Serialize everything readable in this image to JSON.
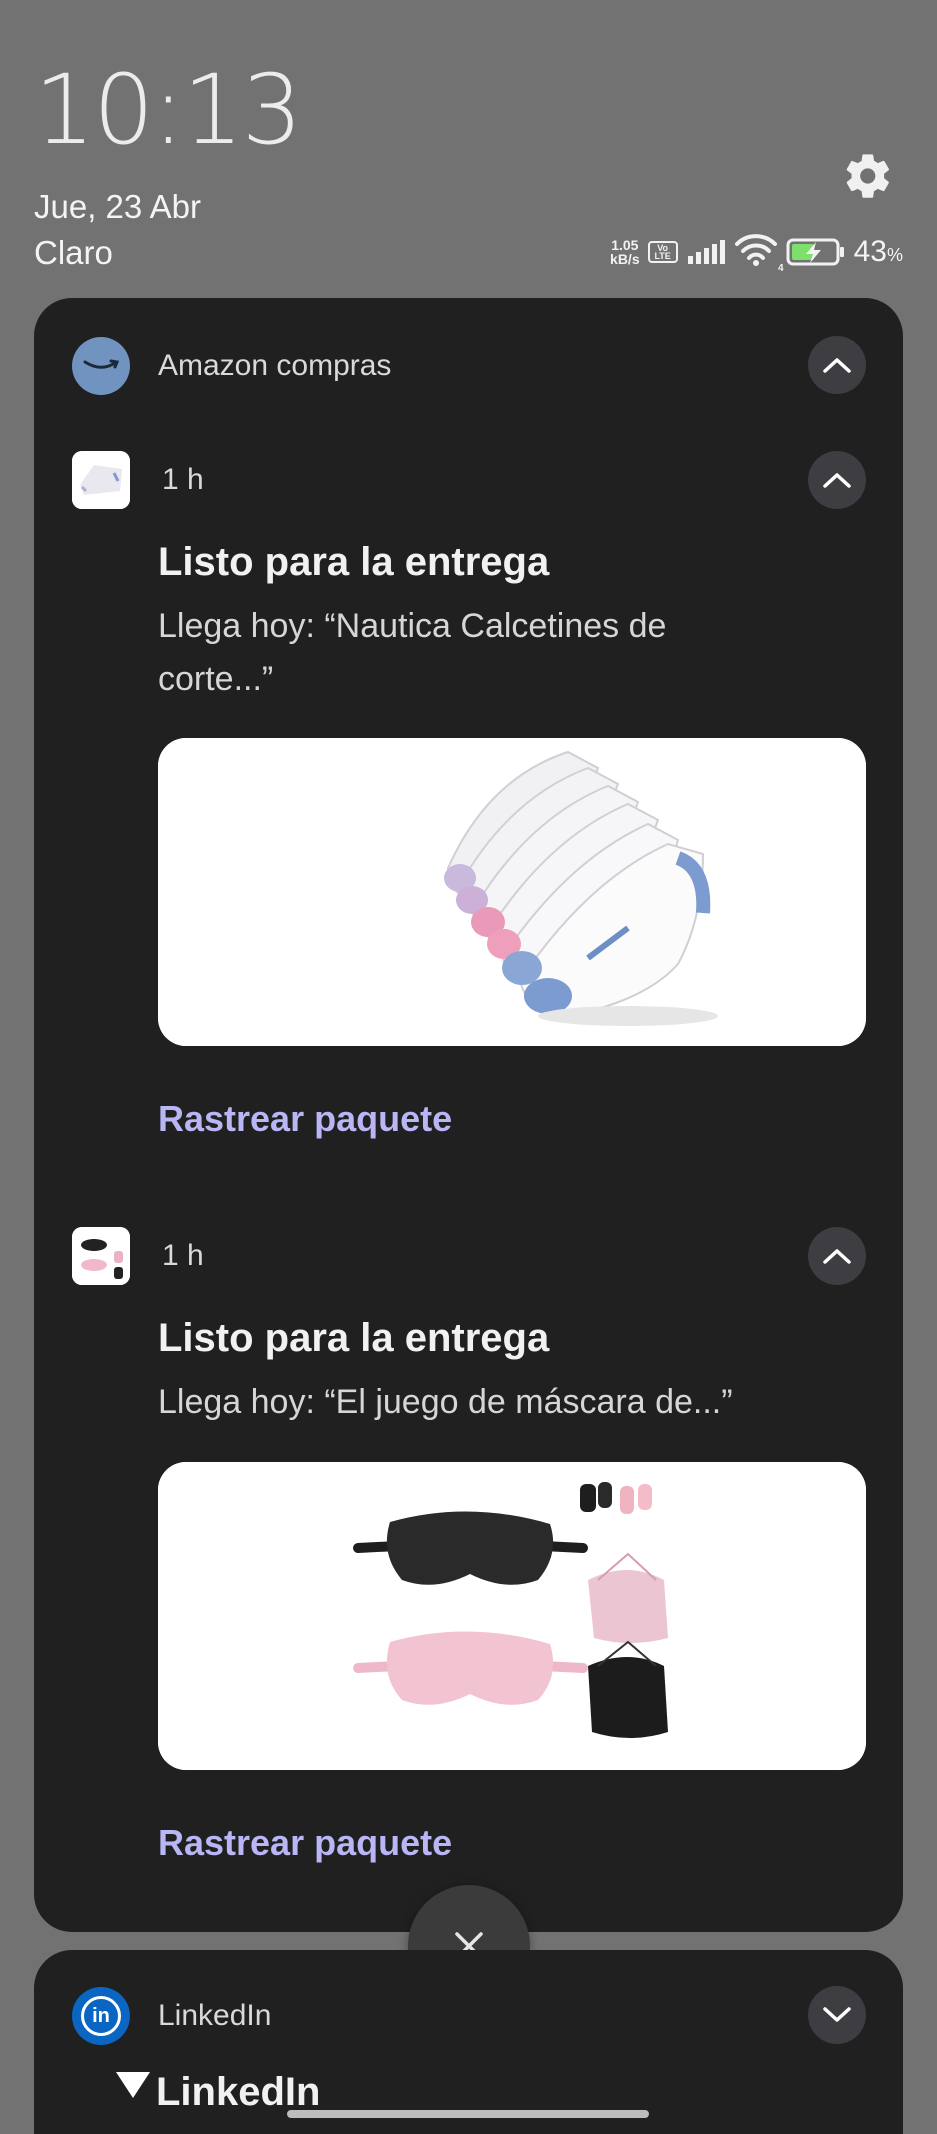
{
  "status": {
    "time": "10:13",
    "date": "Jue, 23 Abr",
    "carrier": "Claro",
    "net_speed_value": "1.05",
    "net_speed_unit": "kB/s",
    "volte_top": "Vo",
    "volte_bottom": "LTE",
    "wifi_tag": "4",
    "battery_percent": "43",
    "battery_unit": "%",
    "icons": [
      "settings-gear-icon",
      "signal-icon",
      "wifi-icon",
      "battery-charging-icon"
    ]
  },
  "amazon_group": {
    "app_name": "Amazon compras",
    "notifications": [
      {
        "time": "1 h",
        "title": "Listo para la entrega",
        "body": "Llega hoy: “Nautica Calcetines de corte...”",
        "action": "Rastrear paquete",
        "image": "socks-product-image"
      },
      {
        "time": "1 h",
        "title": "Listo para la entrega",
        "body": "Llega hoy: “El juego de máscara de...”",
        "action": "Rastrear paquete",
        "image": "sleep-mask-set-image"
      }
    ]
  },
  "linkedin_group": {
    "app_name": "LinkedIn",
    "title": "LinkedIn"
  },
  "colors": {
    "background": "#727272",
    "card": "#202020",
    "action": "#b8b6f4",
    "amazon_icon": "#7193c0",
    "linkedin_icon": "#0a66c2",
    "battery_green": "#7de06a"
  }
}
